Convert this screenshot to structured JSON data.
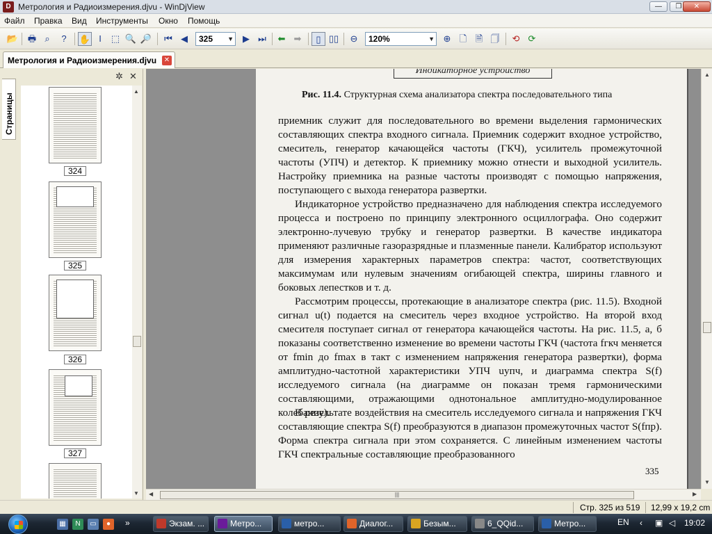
{
  "window": {
    "title": "Метрология и Радиоизмерения.djvu - WinDjView",
    "app_icon": "djvu-app-icon",
    "minimize": "—",
    "maximize": "❐",
    "close": "✕"
  },
  "menu": [
    "Файл",
    "Правка",
    "Вид",
    "Инструменты",
    "Окно",
    "Помощь"
  ],
  "toolbar": {
    "page_value": "325",
    "zoom_value": "120%",
    "icons": [
      "open-icon",
      "print-icon",
      "find-icon",
      "help-icon",
      "hand-tool-icon",
      "text-select-icon",
      "rect-select-icon",
      "zoom-icon",
      "zoom-rect-icon",
      "first-page-icon",
      "prev-page-icon",
      "next-page-icon",
      "last-page-icon",
      "back-icon",
      "forward-icon",
      "single-page-icon",
      "facing-pages-icon",
      "zoom-out-icon",
      "zoom-in-icon",
      "fit-page-icon",
      "fit-width-icon",
      "actual-size-icon",
      "rotate-left-icon",
      "rotate-right-icon"
    ]
  },
  "doc_tab": {
    "label": "Метрология и Радиоизмерения.djvu",
    "close": "✕"
  },
  "sidebar": {
    "tab_label": "Страницы",
    "thumbnails": [
      "324",
      "325",
      "326",
      "327"
    ]
  },
  "page": {
    "figure_box": "Индикаторное устройство",
    "caption_bold": "Рис. 11.4.",
    "caption_text": " Структурная схема анализатора спектра последовательного типа",
    "p1": "приемник служит для последовательного во времени выделения гармонических составляющих спектра входного сигнала. Приемник содержит входное устройство, смеситель, генератор качающейся частоты (ГКЧ), усилитель промежуточной частоты (УПЧ) и детектор. К приемнику можно отнести и выходной усилитель. Настройку приемника на разные частоты производят с помощью напряжения, поступающего с выхода генератора развертки.",
    "p2": "Индикаторное устройство предназначено для наблюдения спектра исследуемого процесса и построено по принципу электронного осциллографа. Оно содержит электронно-лучевую трубку и генератор развертки. В качестве индикатора применяют различные газоразрядные и плазменные панели. Калибратор используют для измерения характерных параметров спектра: частот, соответствующих максимумам или нулевым значениям огибающей спектра, ширины главного и боковых лепестков и т. д.",
    "p3": "Рассмотрим процессы, протекающие в анализаторе спектра (рис. 11.5). Входной сигнал u(t) подается на смеситель через входное устройство. На второй вход смесителя поступает сигнал от генератора качающейся частоты. На рис. 11.5, а, б показаны соответственно изменение во времени частоты ГКЧ (частота fгкч меняется от fmin до fmax в такт с изменением напряжения генератора развертки), форма амплитудно-частотной характеристики УПЧ uупч, и диаграмма спектра S(f) исследуемого сигнала (на диаграмме он показан тремя гармоническими составляющими, отражающими однотональное амплитудно-модулированное колебание).",
    "p4": "В результате воздействия на смеситель исследуемого сигнала и напряжения ГКЧ составляющие спектра S(f) преобразуются в диапазон промежуточных частот S(fпр). Форма спектра сигнала при этом сохраняется. С линейным изменением частоты ГКЧ спектральные составляющие преобразованного",
    "number": "335"
  },
  "status": {
    "page_info": "Стр. 325 из 519",
    "size_info": "12,99 x 19,2 cm"
  },
  "taskbar": {
    "tasks": [
      "Экзам. ...",
      "Метро...",
      "метро...",
      "Диалог...",
      "Безым...",
      "6_QQid...",
      "Метро..."
    ],
    "lang": "EN",
    "clock": "19:02",
    "more": "»"
  },
  "colors": {
    "accent": "#1d3d8f",
    "close_red": "#d9463a",
    "viewer_bg": "#8e8e8e",
    "taskbar": "#1d2733"
  }
}
